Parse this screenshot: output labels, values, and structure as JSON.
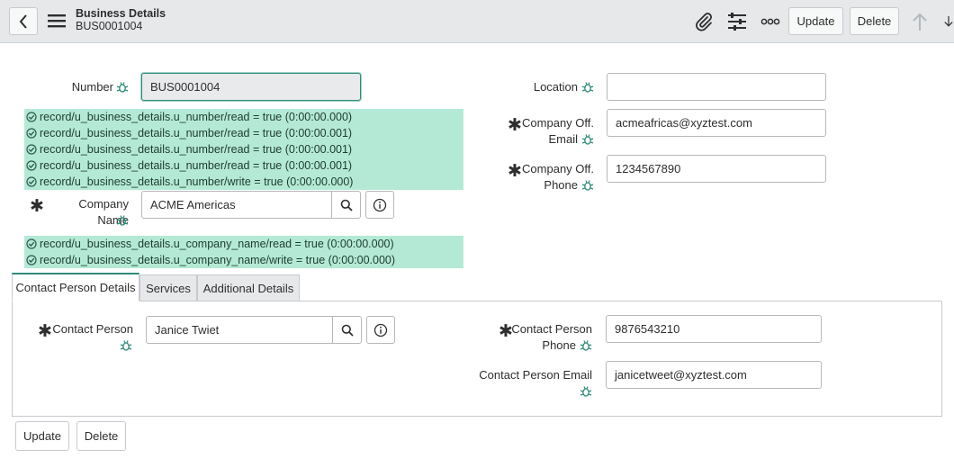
{
  "header": {
    "title": "Business Details",
    "subtitle": "BUS0001004",
    "update_label": "Update",
    "delete_label": "Delete"
  },
  "form": {
    "number": {
      "label": "Number",
      "value": "BUS0001004"
    },
    "location": {
      "label": "Location",
      "value": ""
    },
    "company_email": {
      "label_line1": "Company Off.",
      "label_line2": "Email",
      "value": "acmeafricas@xyztest.com"
    },
    "company_phone": {
      "label_line1": "Company Off.",
      "label_line2": "Phone",
      "value": "1234567890"
    },
    "company_name": {
      "label": "Company Name",
      "value": "ACME Americas"
    }
  },
  "debug": {
    "number_lines": [
      "record/u_business_details.u_number/read = true (0:00:00.000)",
      "record/u_business_details.u_number/read = true (0:00:00.001)",
      "record/u_business_details.u_number/read = true (0:00:00.001)",
      "record/u_business_details.u_number/read = true (0:00:00.001)",
      "record/u_business_details.u_number/write = true (0:00:00.000)"
    ],
    "company_name_lines": [
      "record/u_business_details.u_company_name/read = true (0:00:00.000)",
      "record/u_business_details.u_company_name/write = true (0:00:00.000)"
    ]
  },
  "tabs": [
    {
      "label": "Contact Person Details",
      "active": true
    },
    {
      "label": "Services",
      "active": false
    },
    {
      "label": "Additional Details",
      "active": false
    }
  ],
  "contact": {
    "person": {
      "label": "Contact Person",
      "value": "Janice Twiet"
    },
    "phone": {
      "label_line1": "Contact Person",
      "label_line2": "Phone",
      "value": "9876543210"
    },
    "email": {
      "label": "Contact Person Email",
      "value": "janicetweet@xyztest.com"
    }
  },
  "footer": {
    "update_label": "Update",
    "delete_label": "Delete"
  },
  "colors": {
    "debug_bg": "#b4ead5",
    "accent": "#2f8b7a",
    "header_bg": "#e6e8ea"
  }
}
